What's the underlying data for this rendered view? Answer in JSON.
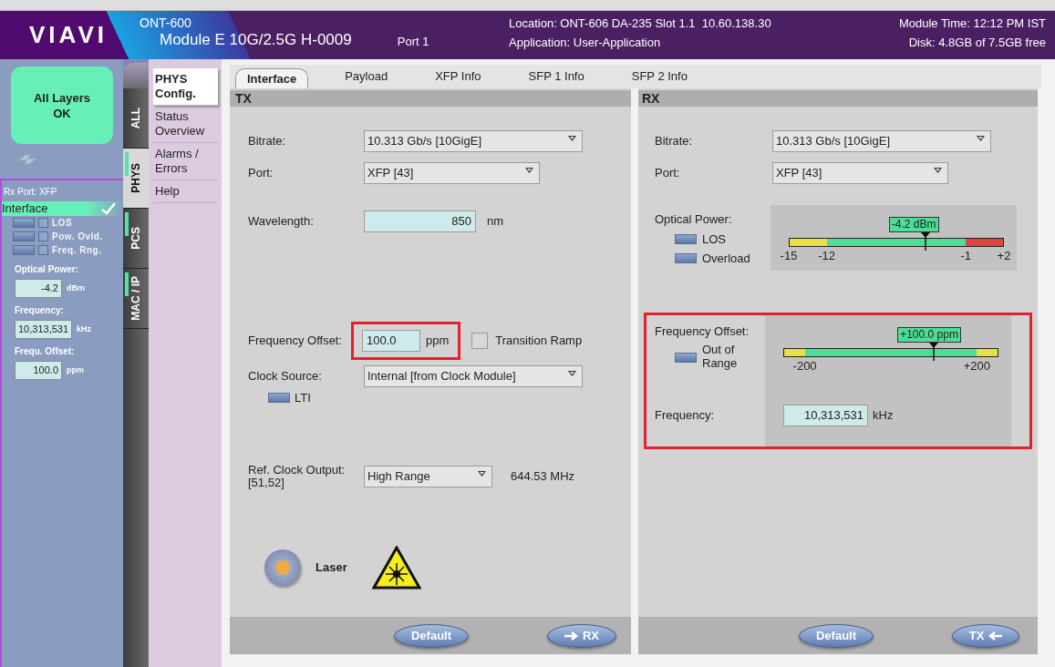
{
  "header": {
    "logo": "VIAVI",
    "product": "ONT-600",
    "module": "Module E 10G/2.5G H-0009",
    "port": "Port 1",
    "location": "Location: ONT-606 DA-235 Slot 1.1  10.60.138.30",
    "application": "Application: User-Application",
    "module_time": "Module Time: 12:12 PM IST",
    "disk": "Disk: 4.8GB of 7.5GB free"
  },
  "sidebar": {
    "status": "All Layers OK",
    "rx_port": "Rx Port: XFP",
    "interface": {
      "label": "Interface",
      "ok": true
    },
    "alarms": [
      {
        "label": "LOS",
        "on": false
      },
      {
        "label": "Pow. Ovld.",
        "on": false
      },
      {
        "label": "Freq. Rng.",
        "on": false
      }
    ],
    "readings": [
      {
        "label": "Optical Power:",
        "value": "-4.2",
        "unit": "dBm"
      },
      {
        "label": "Frequency:",
        "value": "10,313,531",
        "unit": "kHz"
      },
      {
        "label": "Frequ. Offset:",
        "value": "100.0",
        "unit": "ppm"
      }
    ]
  },
  "vertical_tabs": [
    {
      "label": "ALL",
      "selected": false,
      "indicator": false
    },
    {
      "label": "PHYS",
      "selected": true,
      "indicator": true
    },
    {
      "label": "PCS",
      "selected": false,
      "indicator": true
    },
    {
      "label": "MAC / IP",
      "selected": false,
      "indicator": true
    }
  ],
  "menu": [
    {
      "label": "PHYS Config.",
      "selected": true
    },
    {
      "label": "Status Overview",
      "selected": false
    },
    {
      "label": "Alarms / Errors",
      "selected": false
    },
    {
      "label": "Help",
      "selected": false
    }
  ],
  "tabs": [
    {
      "label": "Interface",
      "selected": true
    },
    {
      "label": "Payload",
      "selected": false
    },
    {
      "label": "XFP Info",
      "selected": false
    },
    {
      "label": "SFP 1 Info",
      "selected": false
    },
    {
      "label": "SFP 2 Info",
      "selected": false
    }
  ],
  "tx": {
    "title": "TX",
    "bitrate": {
      "label": "Bitrate:",
      "value": "10.313 Gb/s [10GigE]"
    },
    "port": {
      "label": "Port:",
      "value": "XFP [43]"
    },
    "wavelength": {
      "label": "Wavelength:",
      "value": "850",
      "unit": "nm"
    },
    "frequency_offset": {
      "label": "Frequency Offset:",
      "value": "100.0",
      "unit": "ppm",
      "highlighted": true
    },
    "transition_ramp": {
      "label": "Transition Ramp",
      "checked": false
    },
    "clock_source": {
      "label": "Clock Source:",
      "value": "Internal [from Clock Module]"
    },
    "lti": {
      "label": "LTI",
      "on": false
    },
    "ref_clock": {
      "label": "Ref. Clock Output:",
      "sublabel": "[51,52]",
      "value": "High Range",
      "reading": "644.53 MHz"
    },
    "laser": {
      "label": "Laser",
      "on": false
    },
    "buttons": [
      {
        "label": "Default",
        "kind": "plain"
      },
      {
        "label": "RX",
        "kind": "arrow_right"
      }
    ]
  },
  "rx": {
    "title": "RX",
    "bitrate": {
      "label": "Bitrate:",
      "value": "10.313 Gb/s [10GigE]"
    },
    "port": {
      "label": "Port:",
      "value": "XFP [43]"
    },
    "optical_power": {
      "label": "Optical Power:",
      "alarms": [
        {
          "label": "LOS",
          "on": false
        },
        {
          "label": "Overload",
          "on": false
        }
      ],
      "gauge": {
        "reading": "-4.2 dBm",
        "level": 0.635,
        "ticks": [
          "-15",
          "-12",
          "-1",
          "+2"
        ]
      }
    },
    "frequency_offset": {
      "label": "Frequency Offset:",
      "highlighted": true,
      "alarms": [
        {
          "label": "Out of Range",
          "on": false
        }
      ],
      "gauge": {
        "reading": "+100.0 ppm",
        "level": 0.7,
        "ticks": [
          "-200",
          "+200"
        ]
      }
    },
    "frequency": {
      "label": "Frequency:",
      "value": "10,313,531",
      "unit": "kHz"
    },
    "buttons": [
      {
        "label": "Default",
        "kind": "plain"
      },
      {
        "label": "TX",
        "kind": "arrow_left"
      }
    ]
  }
}
